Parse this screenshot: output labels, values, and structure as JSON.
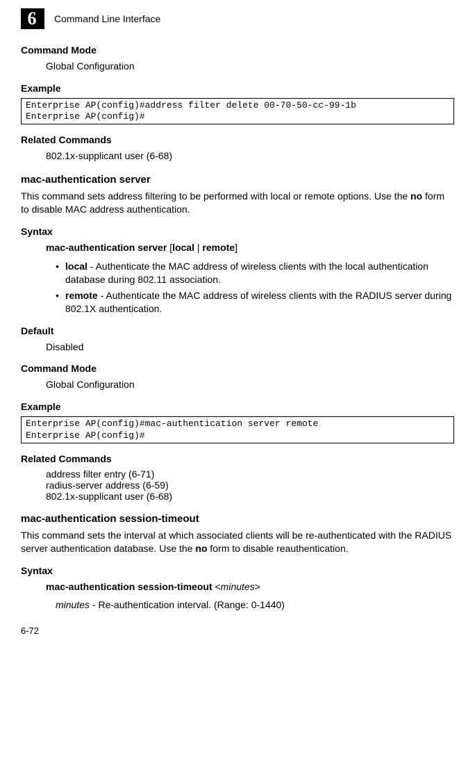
{
  "chapter_number": "6",
  "header_title": "Command Line Interface",
  "s1_h_cmdmode": "Command Mode",
  "s1_cmdmode_text": "Global Configuration",
  "s1_h_example": "Example",
  "s1_example_code": "Enterprise AP(config)#address filter delete 00-70-50-cc-99-1b\nEnterprise AP(config)#",
  "s1_h_related": "Related Commands",
  "s1_related_text": "802.1x-supplicant user (6-68)",
  "cmd1_title": "mac-authentication server",
  "cmd1_desc_pre": "This command sets address filtering to be performed with local or remote options. Use the ",
  "cmd1_desc_no": "no",
  "cmd1_desc_post": " form to disable MAC address authentication.",
  "cmd1_h_syntax": "Syntax",
  "cmd1_syntax_cmd": "mac-authentication server",
  "cmd1_syntax_lbracket": " [",
  "cmd1_syntax_opt1": "local",
  "cmd1_syntax_pipe": " | ",
  "cmd1_syntax_opt2": "remote",
  "cmd1_syntax_rbracket": "]",
  "cmd1_bullet1_kw": "local",
  "cmd1_bullet1_rest": " - Authenticate the MAC address of wireless clients with the local authentication database during 802.11 association.",
  "cmd1_bullet2_kw": "remote",
  "cmd1_bullet2_rest": " - Authenticate the MAC address of wireless clients with the RADIUS server during 802.1X authentication.",
  "cmd1_h_default": "Default",
  "cmd1_default_text": "Disabled",
  "cmd1_h_cmdmode": "Command Mode",
  "cmd1_cmdmode_text": "Global Configuration",
  "cmd1_h_example": "Example",
  "cmd1_example_code": "Enterprise AP(config)#mac-authentication server remote\nEnterprise AP(config)#",
  "cmd1_h_related": "Related Commands",
  "cmd1_related_1": "address filter entry (6-71)",
  "cmd1_related_2": "radius-server address (6-59)",
  "cmd1_related_3": "802.1x-supplicant user (6-68)",
  "cmd2_title": "mac-authentication session-timeout",
  "cmd2_desc_pre": "This command sets the interval at which associated clients will be re-authenticated with the RADIUS server authentication database. Use the ",
  "cmd2_desc_no": "no",
  "cmd2_desc_post": " form to disable reauthentication.",
  "cmd2_h_syntax": "Syntax",
  "cmd2_syntax_cmd": "mac-authentication session-timeout ",
  "cmd2_syntax_lt": "<",
  "cmd2_syntax_param": "minutes",
  "cmd2_syntax_gt": ">",
  "cmd2_param_name": "minutes",
  "cmd2_param_rest": " - Re-authentication interval. (Range: 0-1440)",
  "footer_text": "6-72"
}
